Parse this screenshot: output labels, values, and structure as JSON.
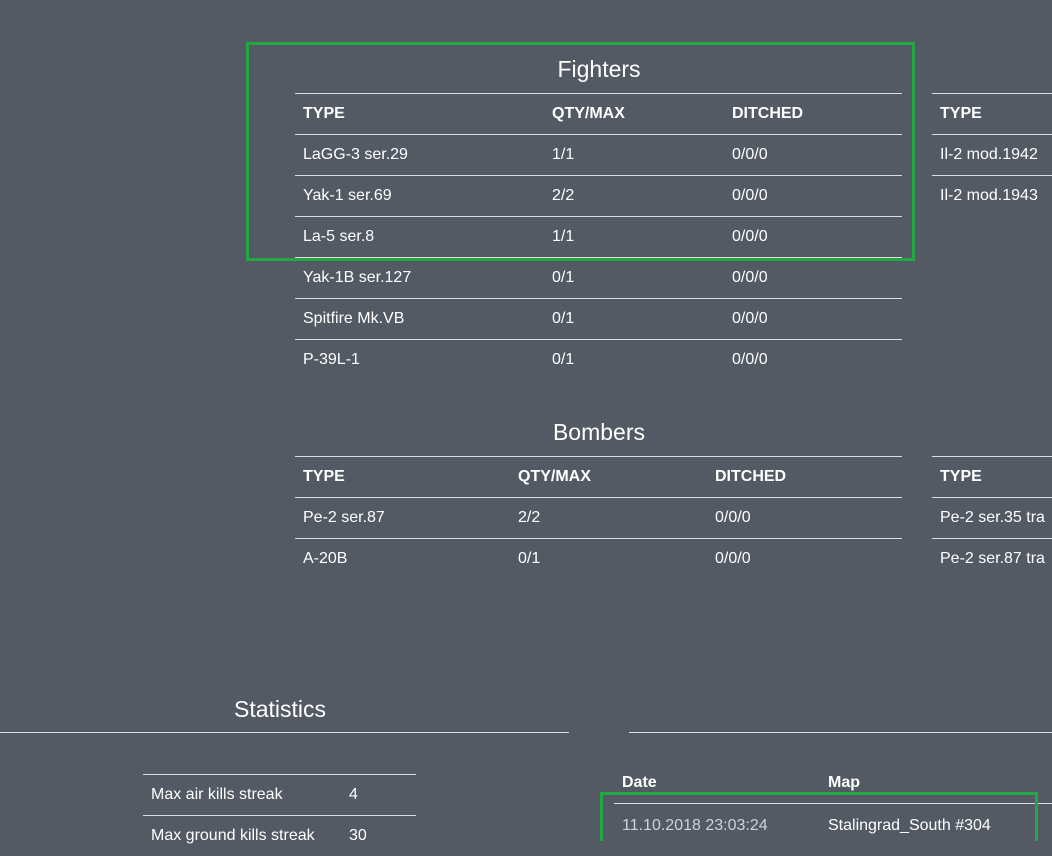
{
  "fighters": {
    "title": "Fighters",
    "columns": [
      "TYPE",
      "QTY/MAX",
      "DITCHED"
    ],
    "rows": [
      [
        "LaGG-3 ser.29",
        "1/1",
        "0/0/0"
      ],
      [
        "Yak-1 ser.69",
        "2/2",
        "0/0/0"
      ],
      [
        "La-5 ser.8",
        "1/1",
        "0/0/0"
      ],
      [
        "Yak-1B ser.127",
        "0/1",
        "0/0/0"
      ],
      [
        "Spitfire Mk.VB",
        "0/1",
        "0/0/0"
      ],
      [
        "P-39L-1",
        "0/1",
        "0/0/0"
      ]
    ]
  },
  "attackers": {
    "column": "TYPE",
    "rows": [
      "Il-2 mod.1942",
      "Il-2 mod.1943"
    ]
  },
  "bombers": {
    "title": "Bombers",
    "columns": [
      "TYPE",
      "QTY/MAX",
      "DITCHED"
    ],
    "rows": [
      [
        "Pe-2 ser.87",
        "2/2",
        "0/0/0"
      ],
      [
        "A-20B",
        "0/1",
        "0/0/0"
      ]
    ]
  },
  "transports": {
    "column": "TYPE",
    "rows": [
      "Pe-2 ser.35 tra",
      "Pe-2 ser.87 tra"
    ]
  },
  "statistics": {
    "title": "Statistics",
    "rows": [
      [
        "Max air kills streak",
        "4"
      ],
      [
        "Max ground kills streak",
        "30"
      ]
    ]
  },
  "missions": {
    "columns": [
      "Date",
      "Map"
    ],
    "rows": [
      [
        "11.10.2018 23:03:24",
        "Stalingrad_South #304"
      ]
    ]
  },
  "colors": {
    "background": "#535a64",
    "highlight": "#22a843"
  }
}
